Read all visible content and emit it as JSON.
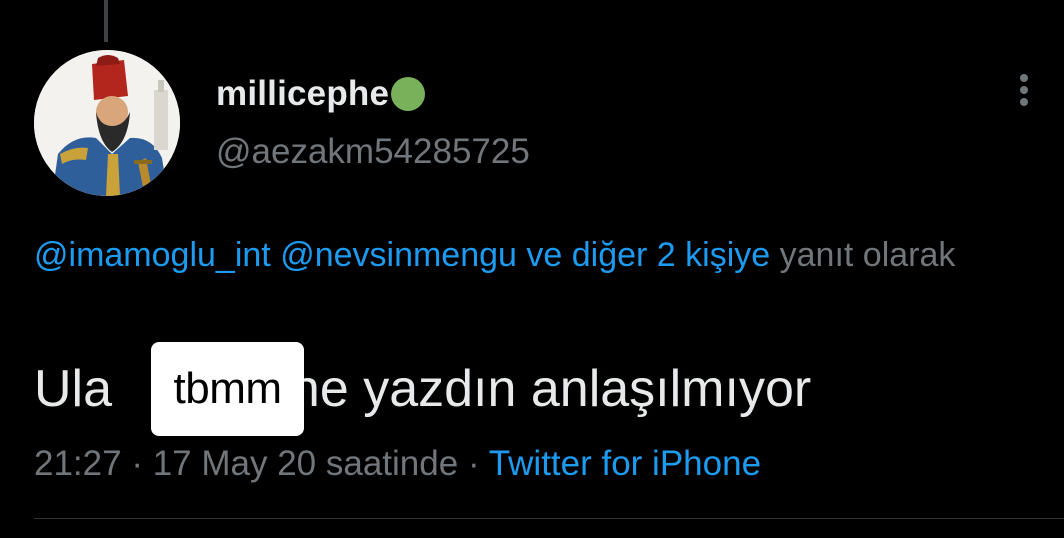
{
  "author": {
    "display_name": "millicephe",
    "handle": "@aezakm54285725",
    "badge_icon": "green-circle-icon",
    "badge_color": "#78b159"
  },
  "reply_context": {
    "mentions": [
      "@imamoglu_int",
      "@nevsinmengu"
    ],
    "others_link": "ve diğer 2 kişiye",
    "suffix": "yanıt olarak"
  },
  "tweet": {
    "text_before": "Ula ",
    "redaction_label": "tbmm",
    "text_after": " ne yazdın anlaşılmıyor"
  },
  "meta": {
    "time": "21:27",
    "separator": "·",
    "date": "17 May 20 saatinde",
    "source": "Twitter for iPhone"
  },
  "colors": {
    "background": "#000000",
    "primary_text": "#e7e9ea",
    "secondary_text": "#71767b",
    "link": "#1d9bf0",
    "redaction_box": "#ffffff"
  },
  "icons": {
    "more": "more-vertical-icon",
    "avatar": "avatar-image"
  }
}
